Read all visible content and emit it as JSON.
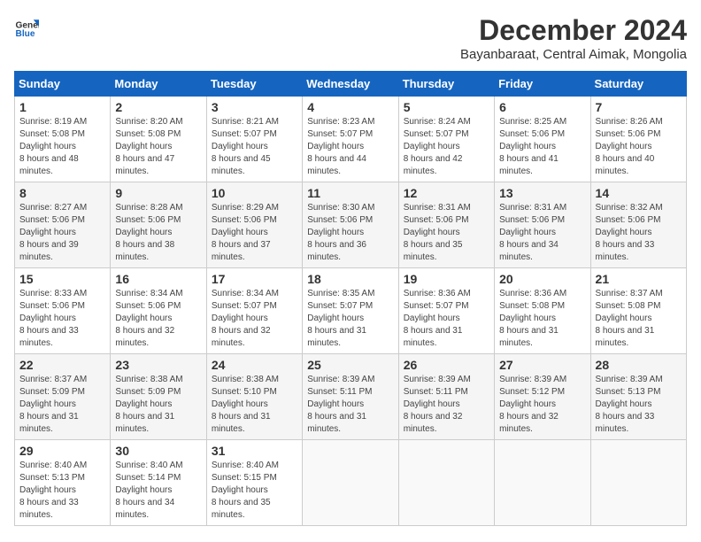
{
  "logo": {
    "line1": "General",
    "line2": "Blue"
  },
  "title": "December 2024",
  "location": "Bayanbaraat, Central Aimak, Mongolia",
  "header": {
    "days": [
      "Sunday",
      "Monday",
      "Tuesday",
      "Wednesday",
      "Thursday",
      "Friday",
      "Saturday"
    ]
  },
  "weeks": [
    [
      {
        "day": "1",
        "sunrise": "8:19 AM",
        "sunset": "5:08 PM",
        "daylight": "8 hours and 48 minutes."
      },
      {
        "day": "2",
        "sunrise": "8:20 AM",
        "sunset": "5:08 PM",
        "daylight": "8 hours and 47 minutes."
      },
      {
        "day": "3",
        "sunrise": "8:21 AM",
        "sunset": "5:07 PM",
        "daylight": "8 hours and 45 minutes."
      },
      {
        "day": "4",
        "sunrise": "8:23 AM",
        "sunset": "5:07 PM",
        "daylight": "8 hours and 44 minutes."
      },
      {
        "day": "5",
        "sunrise": "8:24 AM",
        "sunset": "5:07 PM",
        "daylight": "8 hours and 42 minutes."
      },
      {
        "day": "6",
        "sunrise": "8:25 AM",
        "sunset": "5:06 PM",
        "daylight": "8 hours and 41 minutes."
      },
      {
        "day": "7",
        "sunrise": "8:26 AM",
        "sunset": "5:06 PM",
        "daylight": "8 hours and 40 minutes."
      }
    ],
    [
      {
        "day": "8",
        "sunrise": "8:27 AM",
        "sunset": "5:06 PM",
        "daylight": "8 hours and 39 minutes."
      },
      {
        "day": "9",
        "sunrise": "8:28 AM",
        "sunset": "5:06 PM",
        "daylight": "8 hours and 38 minutes."
      },
      {
        "day": "10",
        "sunrise": "8:29 AM",
        "sunset": "5:06 PM",
        "daylight": "8 hours and 37 minutes."
      },
      {
        "day": "11",
        "sunrise": "8:30 AM",
        "sunset": "5:06 PM",
        "daylight": "8 hours and 36 minutes."
      },
      {
        "day": "12",
        "sunrise": "8:31 AM",
        "sunset": "5:06 PM",
        "daylight": "8 hours and 35 minutes."
      },
      {
        "day": "13",
        "sunrise": "8:31 AM",
        "sunset": "5:06 PM",
        "daylight": "8 hours and 34 minutes."
      },
      {
        "day": "14",
        "sunrise": "8:32 AM",
        "sunset": "5:06 PM",
        "daylight": "8 hours and 33 minutes."
      }
    ],
    [
      {
        "day": "15",
        "sunrise": "8:33 AM",
        "sunset": "5:06 PM",
        "daylight": "8 hours and 33 minutes."
      },
      {
        "day": "16",
        "sunrise": "8:34 AM",
        "sunset": "5:06 PM",
        "daylight": "8 hours and 32 minutes."
      },
      {
        "day": "17",
        "sunrise": "8:34 AM",
        "sunset": "5:07 PM",
        "daylight": "8 hours and 32 minutes."
      },
      {
        "day": "18",
        "sunrise": "8:35 AM",
        "sunset": "5:07 PM",
        "daylight": "8 hours and 31 minutes."
      },
      {
        "day": "19",
        "sunrise": "8:36 AM",
        "sunset": "5:07 PM",
        "daylight": "8 hours and 31 minutes."
      },
      {
        "day": "20",
        "sunrise": "8:36 AM",
        "sunset": "5:08 PM",
        "daylight": "8 hours and 31 minutes."
      },
      {
        "day": "21",
        "sunrise": "8:37 AM",
        "sunset": "5:08 PM",
        "daylight": "8 hours and 31 minutes."
      }
    ],
    [
      {
        "day": "22",
        "sunrise": "8:37 AM",
        "sunset": "5:09 PM",
        "daylight": "8 hours and 31 minutes."
      },
      {
        "day": "23",
        "sunrise": "8:38 AM",
        "sunset": "5:09 PM",
        "daylight": "8 hours and 31 minutes."
      },
      {
        "day": "24",
        "sunrise": "8:38 AM",
        "sunset": "5:10 PM",
        "daylight": "8 hours and 31 minutes."
      },
      {
        "day": "25",
        "sunrise": "8:39 AM",
        "sunset": "5:11 PM",
        "daylight": "8 hours and 31 minutes."
      },
      {
        "day": "26",
        "sunrise": "8:39 AM",
        "sunset": "5:11 PM",
        "daylight": "8 hours and 32 minutes."
      },
      {
        "day": "27",
        "sunrise": "8:39 AM",
        "sunset": "5:12 PM",
        "daylight": "8 hours and 32 minutes."
      },
      {
        "day": "28",
        "sunrise": "8:39 AM",
        "sunset": "5:13 PM",
        "daylight": "8 hours and 33 minutes."
      }
    ],
    [
      {
        "day": "29",
        "sunrise": "8:40 AM",
        "sunset": "5:13 PM",
        "daylight": "8 hours and 33 minutes."
      },
      {
        "day": "30",
        "sunrise": "8:40 AM",
        "sunset": "5:14 PM",
        "daylight": "8 hours and 34 minutes."
      },
      {
        "day": "31",
        "sunrise": "8:40 AM",
        "sunset": "5:15 PM",
        "daylight": "8 hours and 35 minutes."
      },
      null,
      null,
      null,
      null
    ]
  ],
  "labels": {
    "sunrise": "Sunrise:",
    "sunset": "Sunset:",
    "daylight": "Daylight hours"
  }
}
